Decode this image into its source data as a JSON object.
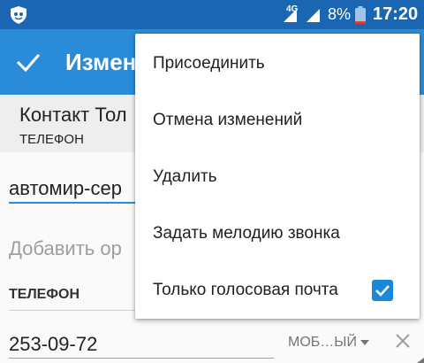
{
  "status_bar": {
    "network": "4G",
    "battery_percent": "8%",
    "time": "17:20",
    "battery_level": 0.08
  },
  "toolbar": {
    "title": "Измен"
  },
  "contact": {
    "name": "Контакт Тол",
    "type": "ТЕЛЕФОН"
  },
  "form": {
    "name_value": "автомир-сер",
    "org_placeholder": "Добавить ор",
    "phone_section_label": "ТЕЛЕФОН",
    "phone_value": "253-09-72",
    "phone_type": "МОБ…ЫЙ"
  },
  "menu": {
    "items": [
      {
        "label": "Присоединить"
      },
      {
        "label": "Отмена изменений"
      },
      {
        "label": "Удалить"
      },
      {
        "label": "Задать мелодию звонка"
      },
      {
        "label": "Только голосовая почта",
        "checked": true
      }
    ]
  },
  "colors": {
    "status_bar": "#1b66b3",
    "toolbar": "#2a8bd9",
    "accent": "#1a88d8"
  }
}
